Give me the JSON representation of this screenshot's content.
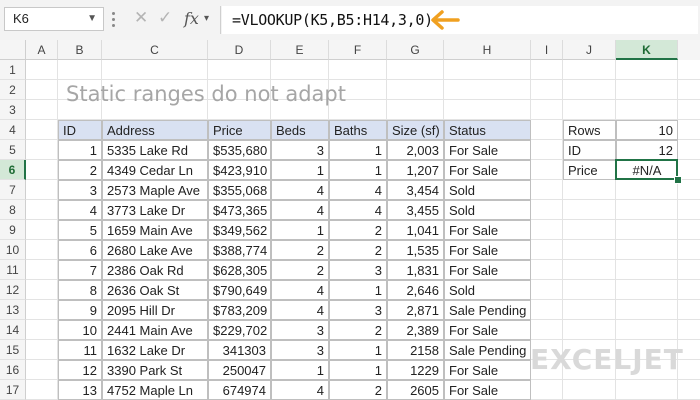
{
  "formula_bar": {
    "name_box": "K6",
    "formula": "=VLOOKUP(K5,B5:H14,3,0)",
    "fx_label": "fx"
  },
  "columns": [
    "A",
    "B",
    "C",
    "D",
    "E",
    "F",
    "G",
    "H",
    "I",
    "J",
    "K"
  ],
  "rows": [
    "1",
    "2",
    "3",
    "4",
    "5",
    "6",
    "7",
    "8",
    "9",
    "10",
    "11",
    "12",
    "13",
    "14",
    "15",
    "16",
    "17"
  ],
  "title": "Static ranges do not adapt",
  "table": {
    "headers": [
      "ID",
      "Address",
      "Price",
      "Beds",
      "Baths",
      "Size (sf)",
      "Status"
    ],
    "rows": [
      [
        "1",
        "5335 Lake Rd",
        "$535,680",
        "3",
        "1",
        "2,003",
        "For Sale"
      ],
      [
        "2",
        "4349 Cedar Ln",
        "$423,910",
        "1",
        "1",
        "1,207",
        "For Sale"
      ],
      [
        "3",
        "2573 Maple Ave",
        "$355,068",
        "4",
        "4",
        "3,454",
        "Sold"
      ],
      [
        "4",
        "3773 Lake Dr",
        "$473,365",
        "4",
        "4",
        "3,455",
        "Sold"
      ],
      [
        "5",
        "1659 Main Ave",
        "$349,562",
        "1",
        "2",
        "1,041",
        "For Sale"
      ],
      [
        "6",
        "2680 Lake Ave",
        "$388,774",
        "2",
        "2",
        "1,535",
        "For Sale"
      ],
      [
        "7",
        "2386 Oak Rd",
        "$628,305",
        "2",
        "3",
        "1,831",
        "For Sale"
      ],
      [
        "8",
        "2636 Oak St",
        "$790,649",
        "4",
        "1",
        "2,646",
        "Sold"
      ],
      [
        "9",
        "2095 Hill Dr",
        "$783,209",
        "4",
        "3",
        "2,871",
        "Sale Pending"
      ],
      [
        "10",
        "2441 Main Ave",
        "$229,702",
        "3",
        "2",
        "2,389",
        "For Sale"
      ],
      [
        "11",
        "1632 Lake Dr",
        "341303",
        "3",
        "1",
        "2158",
        "Sale Pending"
      ],
      [
        "12",
        "3390 Park St",
        "250047",
        "1",
        "1",
        "1229",
        "For Sale"
      ],
      [
        "13",
        "4752 Maple Ln",
        "674974",
        "4",
        "2",
        "2605",
        "For Sale"
      ]
    ]
  },
  "inputs": {
    "rows_label": "Rows",
    "rows_value": "10",
    "id_label": "ID",
    "id_value": "12",
    "price_label": "Price",
    "price_value": "#N/A"
  },
  "colors": {
    "header_fill": "#d9e1f2",
    "selection": "#217346",
    "arrow": "#f0a020"
  },
  "logo": "EXCELJET"
}
